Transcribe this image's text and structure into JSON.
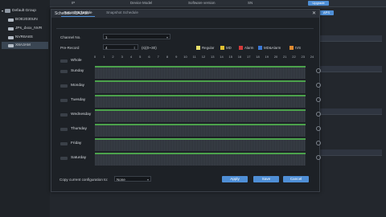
{
  "topbar": {
    "col_ip": "IP",
    "col_model": "Device Model",
    "col_sw": "Software version",
    "col_sn": "SN"
  },
  "tree": {
    "root": "Default Group",
    "items": [
      "BOE2030UN",
      "JPs_dxxx_NVR",
      "NVR6A8S",
      "X8A3AM"
    ]
  },
  "background": {
    "btn1": "Upgrade",
    "btn2": "APS"
  },
  "dialog": {
    "title": "Schedule X8A3AM",
    "close": "✕",
    "tabs": [
      "Record Schedule",
      "Snapshot Schedule"
    ],
    "channel_label": "Channel No.",
    "channel_value": "1",
    "prerecord_label": "Pre-Record",
    "prerecord_value": "4",
    "prerecord_range": "(s)(0~30)",
    "legend": [
      {
        "label": "Regular",
        "color": "#e8e06a"
      },
      {
        "label": "MD",
        "color": "#e0c030"
      },
      {
        "label": "Alarm",
        "color": "#d33a3a"
      },
      {
        "label": "MD&Alarm",
        "color": "#3a78d6"
      },
      {
        "label": "IVS",
        "color": "#e08a30"
      }
    ],
    "scale": [
      "0",
      "1",
      "2",
      "3",
      "4",
      "5",
      "6",
      "7",
      "8",
      "9",
      "10",
      "11",
      "12",
      "13",
      "14",
      "15",
      "16",
      "17",
      "18",
      "19",
      "20",
      "21",
      "22",
      "23",
      "24"
    ],
    "days": [
      "Whole",
      "Sunday",
      "Monday",
      "Tuesday",
      "Wednesday",
      "Thursday",
      "Friday",
      "Saturday"
    ],
    "copy_label": "Copy current configuration to:",
    "copy_value": "None",
    "buttons": {
      "apply": "Apply",
      "save": "Save",
      "cancel": "Cancel"
    }
  }
}
